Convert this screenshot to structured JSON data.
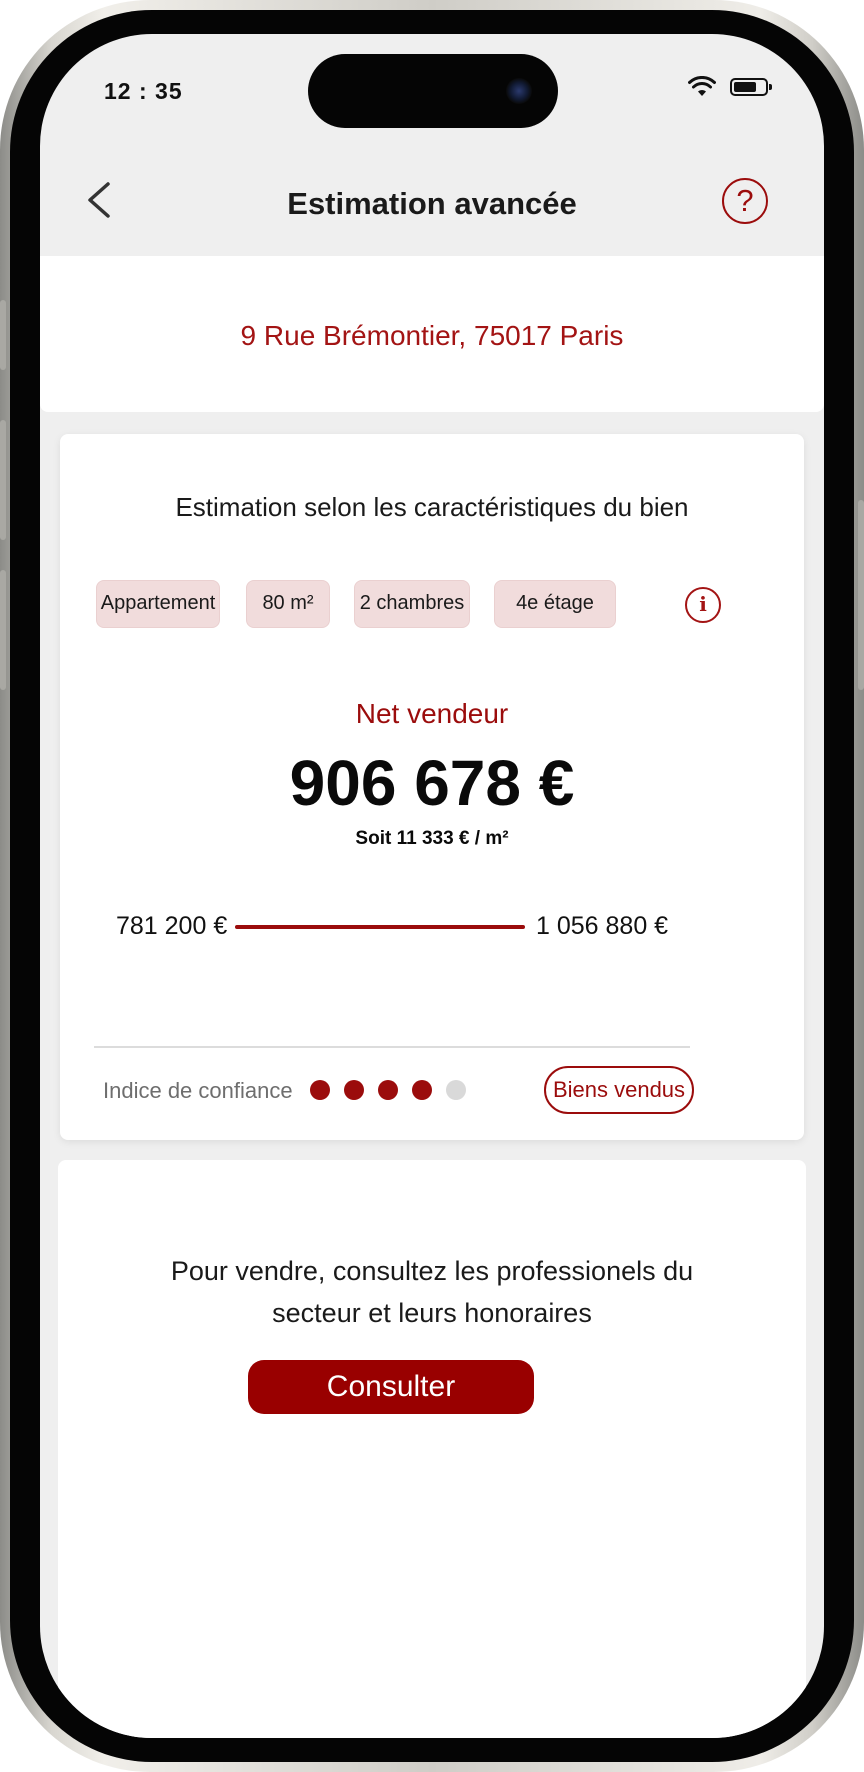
{
  "status_bar": {
    "time": "12 : 35"
  },
  "header": {
    "title": "Estimation avancée",
    "help_label": "?"
  },
  "address": "9 Rue Brémontier, 75017 Paris",
  "estimate": {
    "heading": "Estimation selon les caractéristiques du bien",
    "chips": [
      "Appartement",
      "80 m²",
      "2 chambres",
      "4e étage"
    ],
    "info_label": "i",
    "net_label": "Net vendeur",
    "price": "906 678 €",
    "per_m2": "Soit 11 333 € / m²",
    "range_low": "781 200 €",
    "range_high": "1 056 880 €",
    "confidence_label": "Indice de confiance",
    "confidence_score": 4,
    "confidence_max": 5,
    "sold_button": "Biens vendus"
  },
  "consult": {
    "line1": "Pour vendre, consultez les professionels du",
    "line2": "secteur et leurs honoraires",
    "button": "Consulter"
  },
  "colors": {
    "accent": "#9b0c0c",
    "chip_bg": "#f1dcdc",
    "button_bg": "#990000"
  }
}
